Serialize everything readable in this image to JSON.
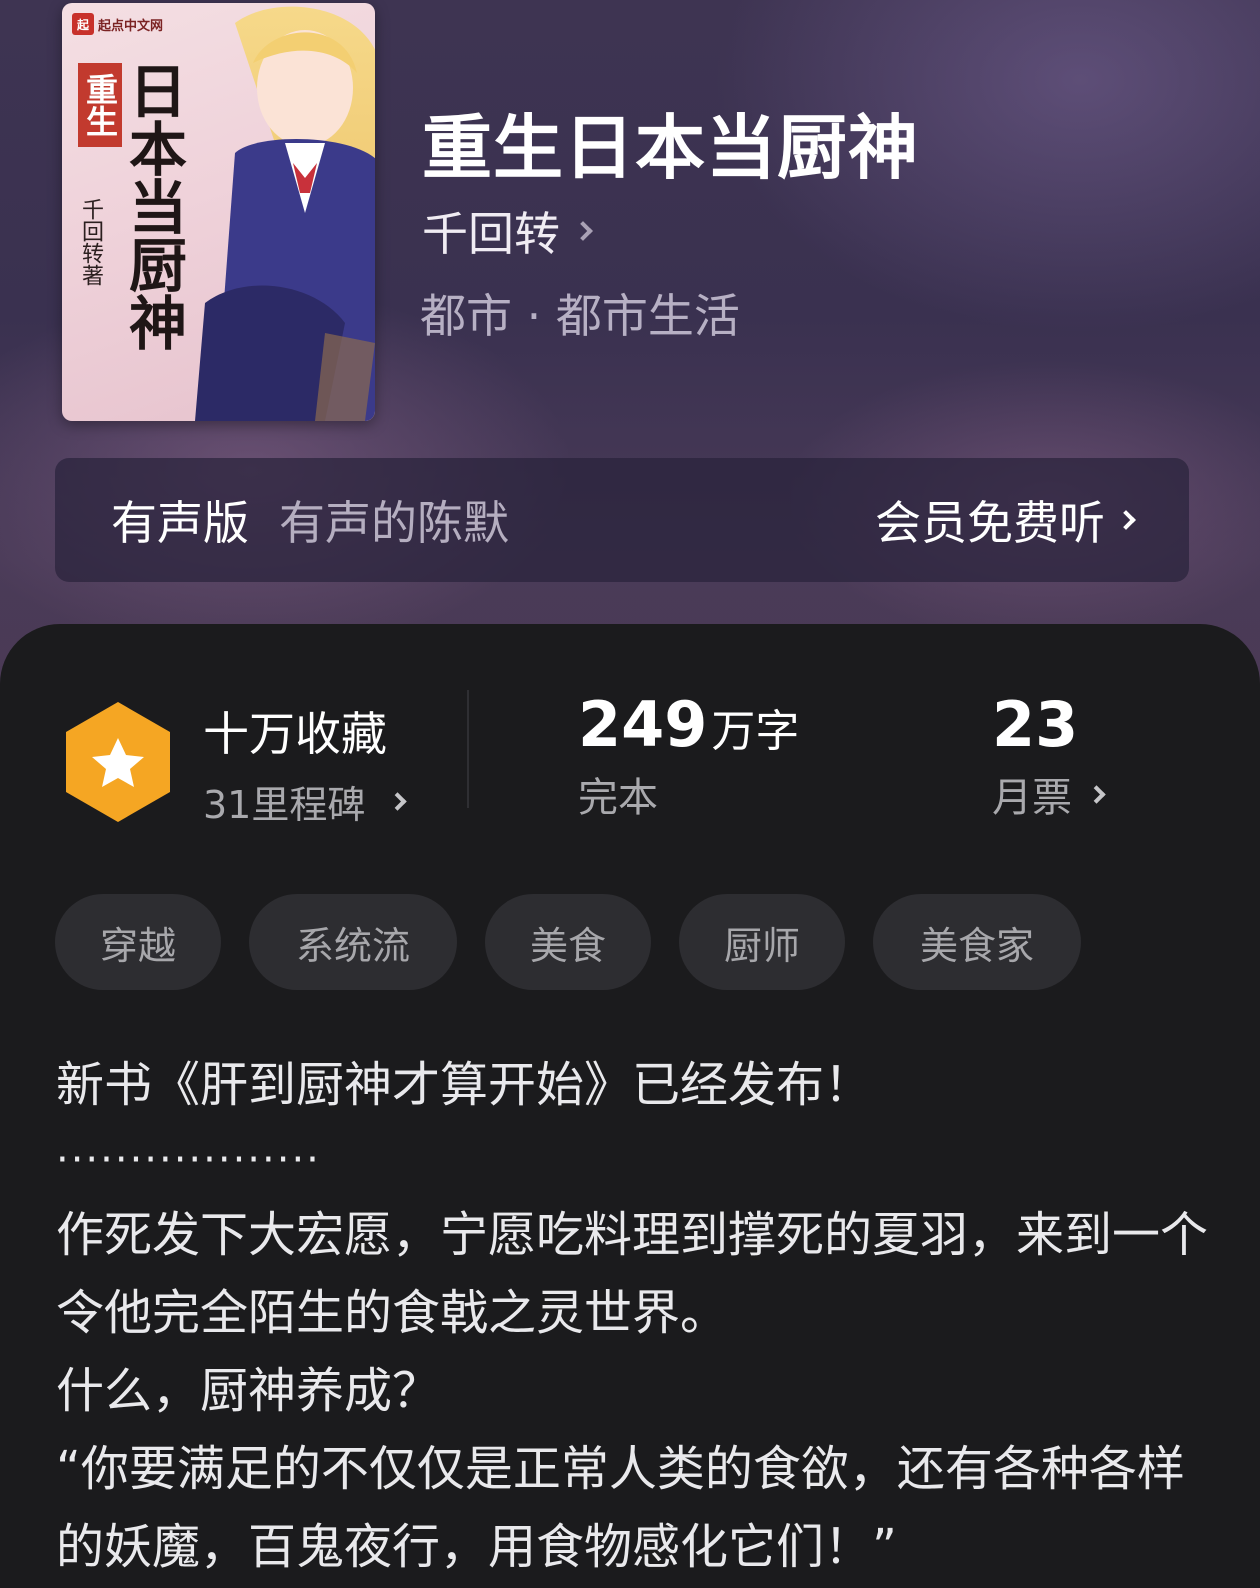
{
  "cover": {
    "publisher": "起点中文网",
    "publisher_badge": "起",
    "tag": "重生",
    "big_title": "日本当厨神",
    "author_text": "千回转著"
  },
  "book": {
    "title": "重生日本当厨神",
    "author": "千回转",
    "category": "都市 · 都市生活"
  },
  "audio": {
    "label": "有声版",
    "narrator": "有声的陈默",
    "cta": "会员免费听"
  },
  "stats": {
    "favorites": "十万收藏",
    "milestones": "31里程碑",
    "word_count": "249",
    "word_unit": "万字",
    "status": "完本",
    "monthly_votes": "23",
    "monthly_votes_label": "月票"
  },
  "tags": [
    "穿越",
    "系统流",
    "美食",
    "厨师",
    "美食家"
  ],
  "intro": {
    "line1": "新书《肝到厨神才算开始》已经发布！",
    "dots": "··················",
    "para1": "作死发下大宏愿，宁愿吃料理到撑死的夏羽，来到一个令他完全陌生的食戟之灵世界。",
    "para2": "什么，厨神养成？",
    "para3": "“你要满足的不仅仅是正常人类的食欲，还有各种各样的妖魔，百鬼夜行，用食物感化它们！”"
  },
  "colors": {
    "medal": "#f5a623",
    "panel_bg": "#1b1b1d",
    "tag_bg": "#2d2d31"
  }
}
